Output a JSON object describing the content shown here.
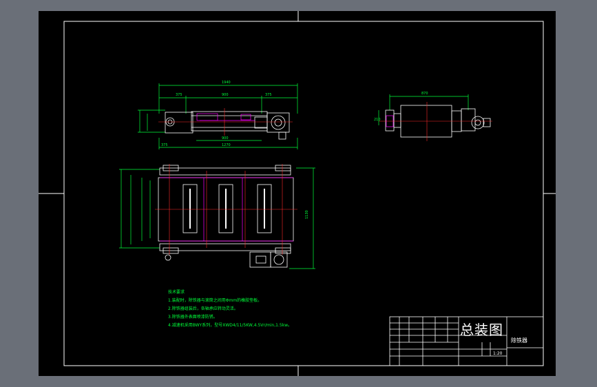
{
  "drawing": {
    "title": "总装图",
    "part_name": "除铁器",
    "scale": "1:20",
    "tech_requirements": {
      "heading": "技术要求",
      "items": [
        "1.装配时，除铁器与滚筒之间用Φmm的橡胶垫板。",
        "2.除铁器组装后，各轴承应转动灵活。",
        "3.除铁器外表面喷漆防锈。",
        "4.减速机采用BWY系列，型号XWD4/11/5KW,4.5Vr/min,1.5kw。"
      ]
    },
    "dimensions": {
      "top_overall": "1940",
      "top_left": "375",
      "top_mid": "900",
      "top_right": "375",
      "bottom_overall": "1270",
      "bottom_inner": "900",
      "bottom_left": "375",
      "side_overall": "870",
      "side_height": "210",
      "front_height": "1130"
    },
    "colors": {
      "background": "#000000",
      "frame": "#ffffff",
      "dimension": "#00ff3a",
      "centerline": "#ff2a2a",
      "hidden": "#ff00ff",
      "outline": "#ffffff"
    }
  }
}
